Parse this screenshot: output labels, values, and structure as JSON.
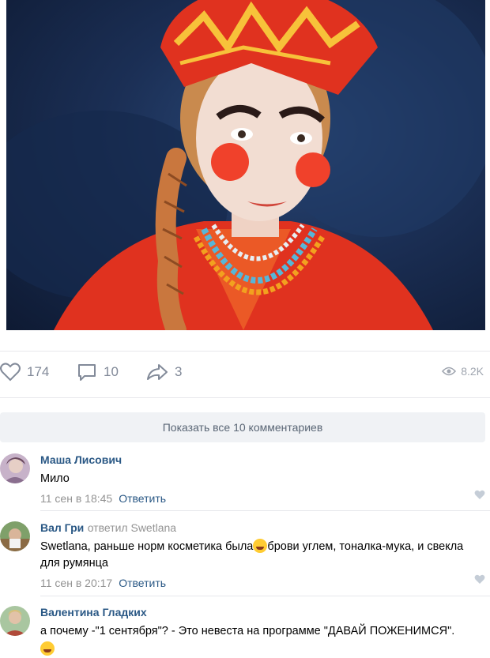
{
  "post": {
    "likes": "174",
    "comments": "10",
    "shares": "3",
    "views": "8.2K"
  },
  "show_all_label": "Показать все 10 комментариев",
  "comments": [
    {
      "author": "Маша Лисович",
      "replied_to": "",
      "text": "Мило",
      "text_after_emoji": "",
      "date": "11 сен в 18:45",
      "reply_label": "Ответить"
    },
    {
      "author": "Вал Гри",
      "replied_to": "ответил Swetlana",
      "text": "Swetlana, раньше норм косметика была",
      "text_after_emoji": "брови углем, тоналка-мука, и свекла для румянца",
      "date": "11 сен в 20:17",
      "reply_label": "Ответить"
    },
    {
      "author": "Валентина Гладких",
      "replied_to": "",
      "text": "а почему -\"1 сентября\"? - Это невеста на программе \"ДАВАЙ ПОЖЕНИМСЯ\".",
      "text_after_emoji": "",
      "date": "",
      "reply_label": ""
    }
  ],
  "colors": {
    "link": "#2a5885",
    "muted": "#939393",
    "icon": "#828a99",
    "show_all_bg": "#f0f2f5"
  }
}
